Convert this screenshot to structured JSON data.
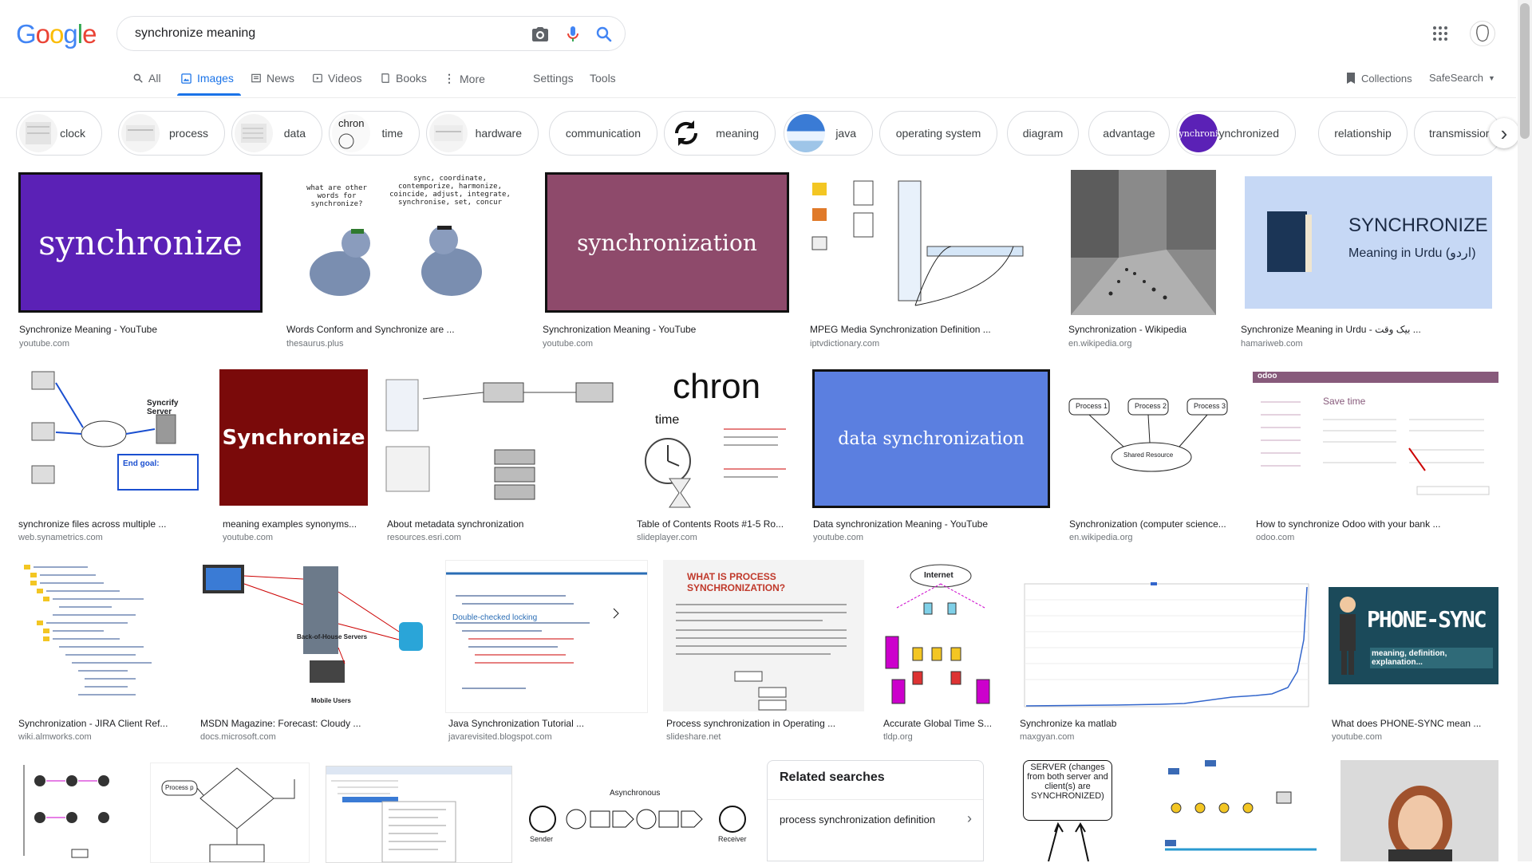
{
  "logo": {
    "letters": [
      "G",
      "o",
      "o",
      "g",
      "l",
      "e"
    ],
    "colors": [
      "#4285F4",
      "#EA4335",
      "#FBBC05",
      "#4285F4",
      "#34A853",
      "#EA4335"
    ]
  },
  "search": {
    "value": "synchronize meaning"
  },
  "nav": {
    "tabs": [
      {
        "label": "All",
        "icon": "search-icon"
      },
      {
        "label": "Images",
        "icon": "image-icon",
        "active": true
      },
      {
        "label": "News",
        "icon": "news-icon"
      },
      {
        "label": "Videos",
        "icon": "video-icon"
      },
      {
        "label": "Books",
        "icon": "book-icon"
      },
      {
        "label": "More",
        "icon": "more-vert-icon"
      }
    ],
    "settings": "Settings",
    "tools": "Tools",
    "collections": "Collections",
    "safesearch": "SafeSearch"
  },
  "chips": [
    "clock",
    "process",
    "data",
    "time",
    "hardware",
    "communication",
    "meaning",
    "java",
    "operating system",
    "diagram",
    "advantage",
    "synchronized",
    "relationship",
    "transmission"
  ],
  "chip_thumb_text": {
    "time": "chron",
    "synchronized": "ynchroni"
  },
  "results": {
    "row1": [
      {
        "title": "Synchronize Meaning - YouTube",
        "source": "youtube.com",
        "image_text": "synchronize"
      },
      {
        "title": "Words Conform and Synchronize are ...",
        "source": "thesaurus.plus",
        "image_text": "sync, coordinate, contemporize, harmonize, coincide, adjust, integrate, synchronise, set, concur",
        "image_text2": "what are other words for synchronize?"
      },
      {
        "title": "Synchronization Meaning - YouTube",
        "source": "youtube.com",
        "image_text": "synchronization"
      },
      {
        "title": "MPEG Media Synchronization Definition ...",
        "source": "iptvdictionary.com"
      },
      {
        "title": "Synchronization - Wikipedia",
        "source": "en.wikipedia.org"
      },
      {
        "title": "Synchronize Meaning in Urdu - بیک وقت ...",
        "source": "hamariweb.com",
        "image_text": "SYNCHRONIZE",
        "image_text2": "Meaning in Urdu (اردو)"
      }
    ],
    "row2": [
      {
        "title": "synchronize files across multiple ...",
        "source": "web.synametrics.com",
        "image_text": "Syncrify Server",
        "image_text2": "End goal:"
      },
      {
        "title": "meaning examples synonyms...",
        "source": "youtube.com",
        "image_text": "Synchronize"
      },
      {
        "title": "About metadata synchronization",
        "source": "resources.esri.com"
      },
      {
        "title": "Table of Contents Roots #1-5 Ro...",
        "source": "slideplayer.com",
        "image_text": "chron",
        "image_text2": "time"
      },
      {
        "title": "Data synchronization Meaning - YouTube",
        "source": "youtube.com",
        "image_text": "data synchronization"
      },
      {
        "title": "Synchronization (computer science...",
        "source": "en.wikipedia.org",
        "image_text": "Process 1",
        "image_text2": "Process 2",
        "image_text3": "Process 3",
        "image_text4": "Shared Resource"
      },
      {
        "title": "How to synchronize Odoo with your bank ...",
        "source": "odoo.com",
        "image_text": "odoo",
        "image_text2": "Save time"
      }
    ],
    "row3": [
      {
        "title": "Synchronization - JIRA Client Ref...",
        "source": "wiki.almworks.com"
      },
      {
        "title": "MSDN Magazine: Forecast: Cloudy ...",
        "source": "docs.microsoft.com",
        "image_text": "Back-of-House Servers",
        "image_text2": "Mobile Users"
      },
      {
        "title": "Java Synchronization Tutorial ...",
        "source": "javarevisited.blogspot.com",
        "image_text": "Double-checked locking"
      },
      {
        "title": "Process synchronization in Operating ...",
        "source": "slideshare.net",
        "image_text": "WHAT IS PROCESS SYNCHRONIZATION?"
      },
      {
        "title": "Accurate Global Time S...",
        "source": "tldp.org",
        "image_text": "Internet"
      },
      {
        "title": "Synchronize ka matlab",
        "source": "maxgyan.com"
      },
      {
        "title": "What does PHONE-SYNC mean ...",
        "source": "youtube.com",
        "image_text": "PHONE-SYNC",
        "image_text2": "meaning, definition, explanation..."
      }
    ],
    "row4_texts": {
      "flow": "Process p",
      "async": "Asynchronous",
      "sender": "Sender",
      "receiver": "Receiver",
      "server": "SERVER (changes from both server and client(s) are SYNCHRONIZED)"
    }
  },
  "related": {
    "title": "Related searches",
    "item": "process synchronization definition"
  },
  "colors": {
    "accent": "#1a73e8",
    "purple": "#5b21b6",
    "mauve": "#8e4a6b",
    "maroon": "#7a0a0a",
    "teal": "#1b4a5a"
  }
}
